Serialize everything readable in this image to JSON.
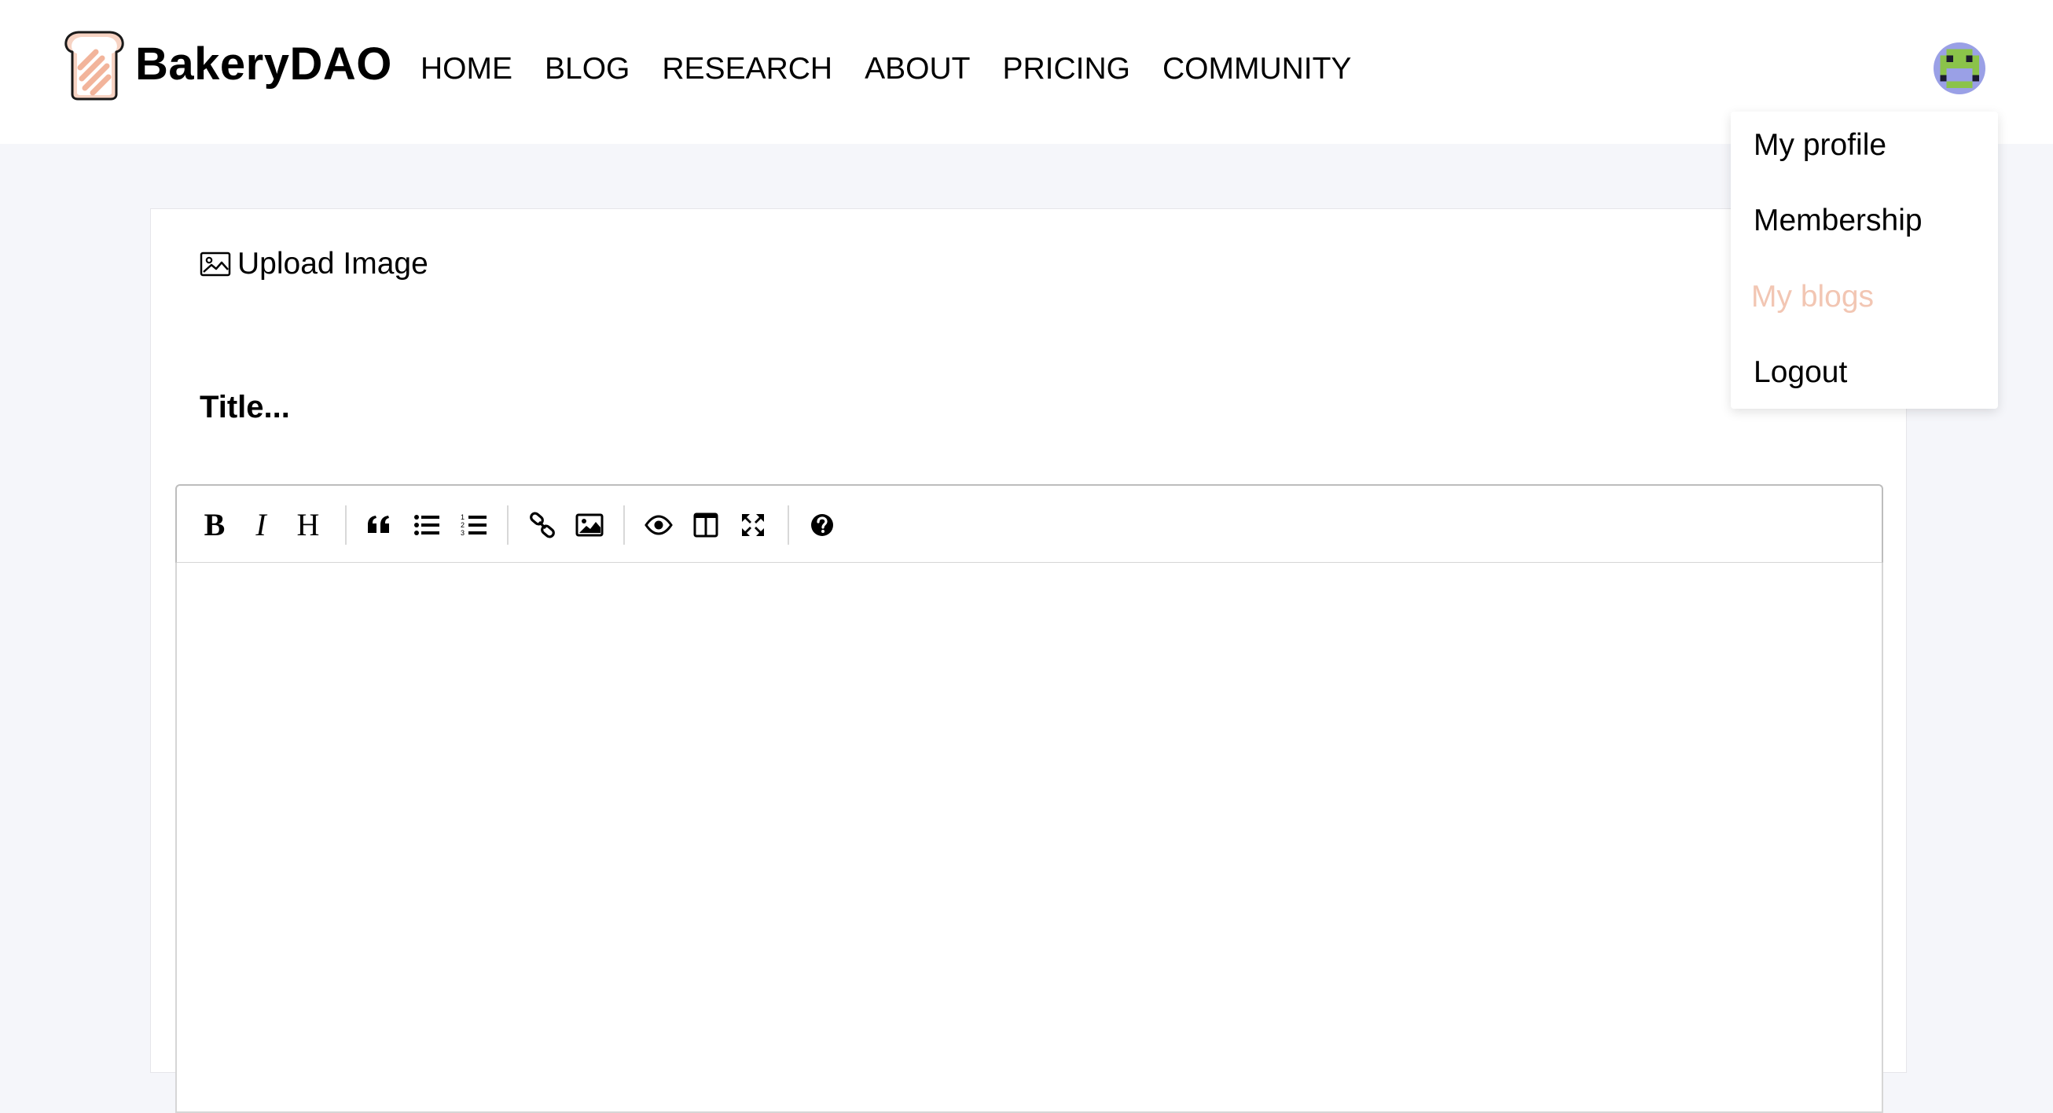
{
  "brand": {
    "name": "BakeryDAO",
    "logo_icon": "bread-toast-icon",
    "accent_color": "#f2c6b3"
  },
  "nav": {
    "items": [
      {
        "label": "HOME"
      },
      {
        "label": "BLOG"
      },
      {
        "label": "RESEARCH"
      },
      {
        "label": "ABOUT"
      },
      {
        "label": "PRICING"
      },
      {
        "label": "COMMUNITY"
      }
    ]
  },
  "user_menu": {
    "avatar_icon": "pixel-avatar-icon",
    "items": [
      {
        "label": "My profile",
        "active": false
      },
      {
        "label": "Membership",
        "active": false
      },
      {
        "label": "My blogs",
        "active": true
      },
      {
        "label": "Logout",
        "active": false
      }
    ]
  },
  "editor": {
    "upload_label": "Upload Image",
    "upload_icon": "image-icon",
    "title_placeholder": "Title...",
    "body_value": "",
    "toolbar": [
      {
        "name": "bold",
        "icon": "bold-icon",
        "glyph": "B"
      },
      {
        "name": "italic",
        "icon": "italic-icon",
        "glyph": "I"
      },
      {
        "name": "heading",
        "icon": "heading-icon",
        "glyph": "H"
      },
      {
        "name": "quote",
        "icon": "quote-icon"
      },
      {
        "name": "unordered-list",
        "icon": "bullet-list-icon"
      },
      {
        "name": "ordered-list",
        "icon": "numbered-list-icon"
      },
      {
        "name": "link",
        "icon": "link-icon"
      },
      {
        "name": "image",
        "icon": "image-icon"
      },
      {
        "name": "preview",
        "icon": "eye-icon"
      },
      {
        "name": "side-by-side",
        "icon": "columns-icon"
      },
      {
        "name": "fullscreen",
        "icon": "fullscreen-icon"
      },
      {
        "name": "guide",
        "icon": "question-circle-icon"
      }
    ]
  }
}
